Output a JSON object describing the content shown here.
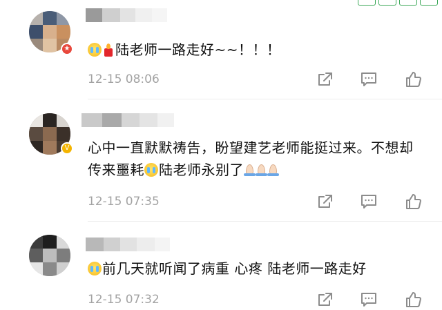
{
  "comments": [
    {
      "segments": [
        "陆老师一路走好~~！！！"
      ],
      "time": "12-15 08:06"
    },
    {
      "segments": [
        "心中一直默默祷告，盼望建艺老师能挺过来。不想却传来噩耗",
        "陆老师永别了"
      ],
      "time": "12-15 07:35"
    },
    {
      "segments": [
        "前几天就听闻了病重 心疼 陆老师一路走好"
      ],
      "time": "12-15 07:32"
    }
  ],
  "icons": {
    "share": "share-icon",
    "comment": "comment-icon",
    "like": "thumbs-up-icon",
    "cry_emoji": "crying-face-emoji",
    "candle_emoji": "candle-emoji",
    "pray_emoji": "folded-hands-emoji"
  },
  "colors": {
    "text": "#111111",
    "time": "#a3a3a3",
    "icon": "#8c8c8c",
    "divider": "#ececec"
  }
}
